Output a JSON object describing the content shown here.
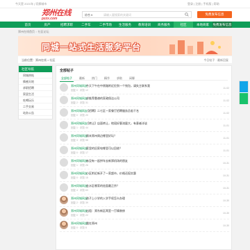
{
  "topbar": {
    "left": "今天是 2021年 | 切换城市",
    "right": "登录 | 注册 | 手机版 | 帮助"
  },
  "logo": {
    "cn": "郑州在线",
    "en": "pzzx.com"
  },
  "search": {
    "select": "综合 ▾",
    "placeholder": "请输入要搜索的关键词"
  },
  "header": {
    "post_label": "免费发布信息"
  },
  "nav": [
    {
      "label": "首页"
    },
    {
      "label": "房产"
    },
    {
      "label": "招聘求职"
    },
    {
      "label": "二手车"
    },
    {
      "label": "二手市场"
    },
    {
      "label": "生活服务"
    },
    {
      "label": "教育培训"
    },
    {
      "label": "商务服务"
    },
    {
      "label": "社区"
    },
    {
      "label": "本地商家"
    },
    {
      "label": "免费发布信息"
    }
  ],
  "crumbs": {
    "home": "郑州在线首页",
    "current": "社区论坛"
  },
  "banner": {
    "text": "同城一站式生活服务平台"
  },
  "locbar": {
    "left": "当前位置：郑州在线 > 社区",
    "right": "今日帖子 · 最新回复"
  },
  "sidebar": {
    "head": "社区导航",
    "items": [
      "同城热帖",
      "情感天地",
      "求职招聘",
      "家居生活",
      "吃喝玩乐",
      "二手交易",
      "站务公告"
    ]
  },
  "main": {
    "title": "全部帖子",
    "tabs": [
      "全部帖子",
      "最新",
      "热门",
      "精华",
      "求助",
      "闲聊"
    ]
  },
  "rows": [
    {
      "author": "郑州同城网友",
      "title": "今天下午在中原路附近捡到一个钱包，请失主联系我",
      "tag": "",
      "meta": "回复 0 · 浏览 12",
      "date": "11-02",
      "pic": false
    },
    {
      "author": "郑州同城网友",
      "title": "求推荐靠谱的家政保洁公司",
      "tag": "",
      "meta": "回复 2 · 浏览 31",
      "date": "11-02",
      "pic": false
    },
    {
      "author": "郑州同城网友",
      "title": "【招聘】二七区一家餐厅招聘服务员若干名",
      "tag": "",
      "meta": "回复 0 · 浏览 20",
      "date": "11-02",
      "pic": false
    },
    {
      "author": "郑州同城网友",
      "title": "【转让】店面转让，地段好客流量大，有意者详谈",
      "tag": "",
      "meta": "回复 1 · 浏览 44",
      "date": "11-01",
      "pic": false
    },
    {
      "author": "郑州同城网友",
      "title": "周末郑州周边哪里好玩？",
      "tag": "",
      "meta": "回复 3 · 浏览 58",
      "date": "11-01",
      "pic": false
    },
    {
      "author": "郑州同城网友",
      "title": "家里的旧家电哪里可以回收？",
      "tag": "",
      "meta": "回复 0 · 浏览 17",
      "date": "11-01",
      "pic": false
    },
    {
      "author": "郑州同城网友",
      "title": "有没有一起拼车去新郑机场的朋友",
      "tag": "",
      "meta": "回复 1 · 浏览 26",
      "date": "10-31",
      "pic": false
    },
    {
      "author": "郑州同城网友",
      "title": "小区附近新开了一家超市，价格还挺实惠",
      "tag": "",
      "meta": "回复 0 · 浏览 15",
      "date": "10-31",
      "pic": false
    },
    {
      "author": "郑州同城网友",
      "title": "金水区哪家的烩面最正宗？",
      "tag": "",
      "meta": "回复 4 · 浏览 63",
      "date": "10-31",
      "pic": false
    },
    {
      "author": "郑州同城网友",
      "title": "孩子上小学的入学手续怎么办理",
      "tag": "",
      "meta": "回复 2 · 浏览 39",
      "date": "10-30",
      "pic": true
    },
    {
      "author": "郑州同城网友",
      "title": "出租：郑东新区两室一厅精装修",
      "tag": "",
      "meta": "回复 0 · 浏览 22",
      "date": "10-30",
      "pic": true
    },
    {
      "author": "郑州同城网友",
      "title": "我在郑州",
      "tag": "",
      "meta": "回复 0 · 浏览 8",
      "date": "10-30",
      "pic": true
    }
  ]
}
